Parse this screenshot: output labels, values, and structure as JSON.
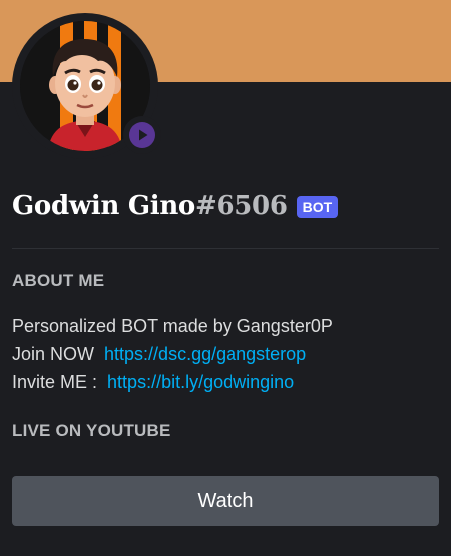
{
  "colors": {
    "banner": "#d99759",
    "background": "#1c1d21",
    "bot_tag": "#5865f2",
    "link": "#00aff4",
    "status_streaming": "#593695",
    "button": "#4f545c"
  },
  "profile": {
    "avatar_icon": "cartoon-avatar-icon",
    "status_icon": "streaming-play-icon",
    "username": "Godwin Gino",
    "discriminator": "#6506",
    "tag": "BOT"
  },
  "about": {
    "title": "ABOUT ME",
    "line1": "Personalized BOT made by Gangster0P",
    "line2_prefix": "Join NOW",
    "line2_link": "https://dsc.gg/gangsterop",
    "line3_prefix": "Invite ME :",
    "line3_link": "https://bit.ly/godwingino"
  },
  "activity": {
    "title": "LIVE ON YOUTUBE",
    "button_label": "Watch"
  }
}
